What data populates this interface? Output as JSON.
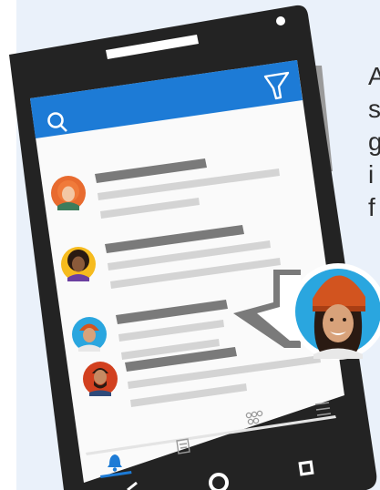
{
  "illustration": {
    "device": "smartphone",
    "app_bar": {
      "color": "#1d7bd6",
      "left_icon": "search-icon",
      "right_icon": "filter-icon"
    },
    "feed": {
      "items": [
        {
          "avatar": "avatar-red-hair-woman"
        },
        {
          "avatar": "avatar-curly-hair-woman"
        },
        {
          "avatar": "avatar-orange-beanie-woman"
        },
        {
          "avatar": "avatar-bearded-man"
        }
      ]
    },
    "bottom_nav": {
      "items": [
        {
          "icon": "bell-icon",
          "active": true,
          "color": "#1d7bd6"
        },
        {
          "icon": "chat-icon",
          "active": false
        },
        {
          "icon": "people-icon",
          "active": false
        },
        {
          "icon": "menu-icon",
          "active": false
        }
      ]
    },
    "callout": {
      "avatar": "avatar-orange-beanie-woman"
    }
  },
  "side_text": {
    "lines": [
      "A",
      "s",
      "g",
      "i",
      "f"
    ]
  },
  "colors": {
    "background": "#eaf1fa",
    "phone_body": "#232323",
    "accent": "#1d7bd6",
    "placeholder_dark": "#7a7a7a",
    "placeholder_light": "#d4d4d4",
    "nav_bar": "#2a2a2a"
  }
}
